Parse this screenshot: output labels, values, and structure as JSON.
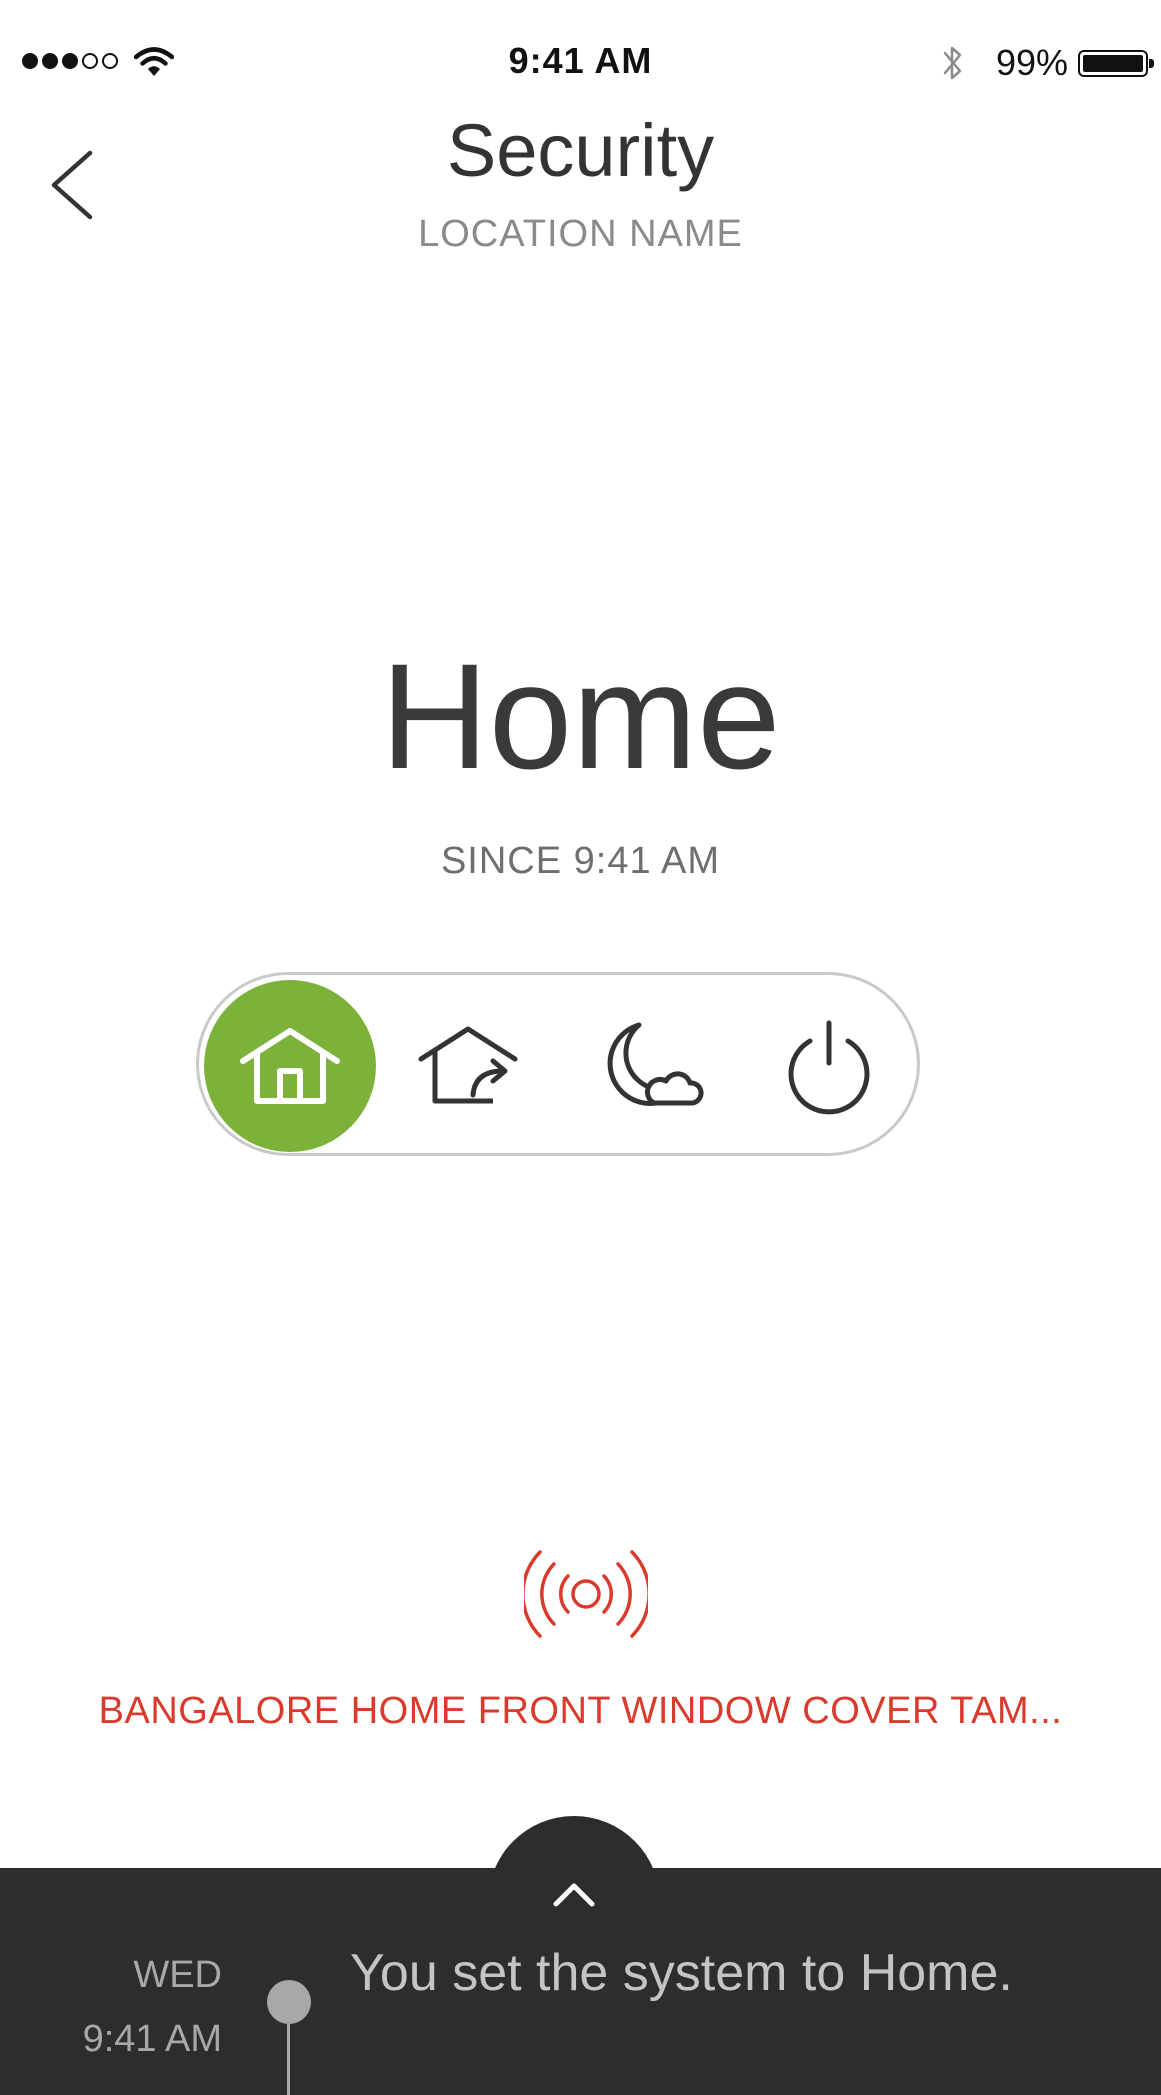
{
  "status_bar": {
    "time": "9:41 AM",
    "battery": "99%",
    "signal_bars_filled": 3,
    "signal_bars_total": 5
  },
  "header": {
    "title": "Security",
    "subtitle": "LOCATION NAME"
  },
  "mode": {
    "name": "Home",
    "since": "SINCE 9:41 AM"
  },
  "mode_selector": {
    "active": "home",
    "options": [
      "home-icon",
      "away-icon",
      "night-icon",
      "off-icon"
    ]
  },
  "alarm": {
    "icon": "alarm-broadcast-icon",
    "text": "BANGALORE HOME FRONT WINDOW COVER TAM..."
  },
  "activity": {
    "day": "WED",
    "time": "9:41 AM",
    "message": "You set the system to Home."
  },
  "colors": {
    "accent_green": "#7db23a",
    "alarm_red": "#d93a2b",
    "panel_dark": "#2d2d2d",
    "text_dark": "#333333"
  }
}
